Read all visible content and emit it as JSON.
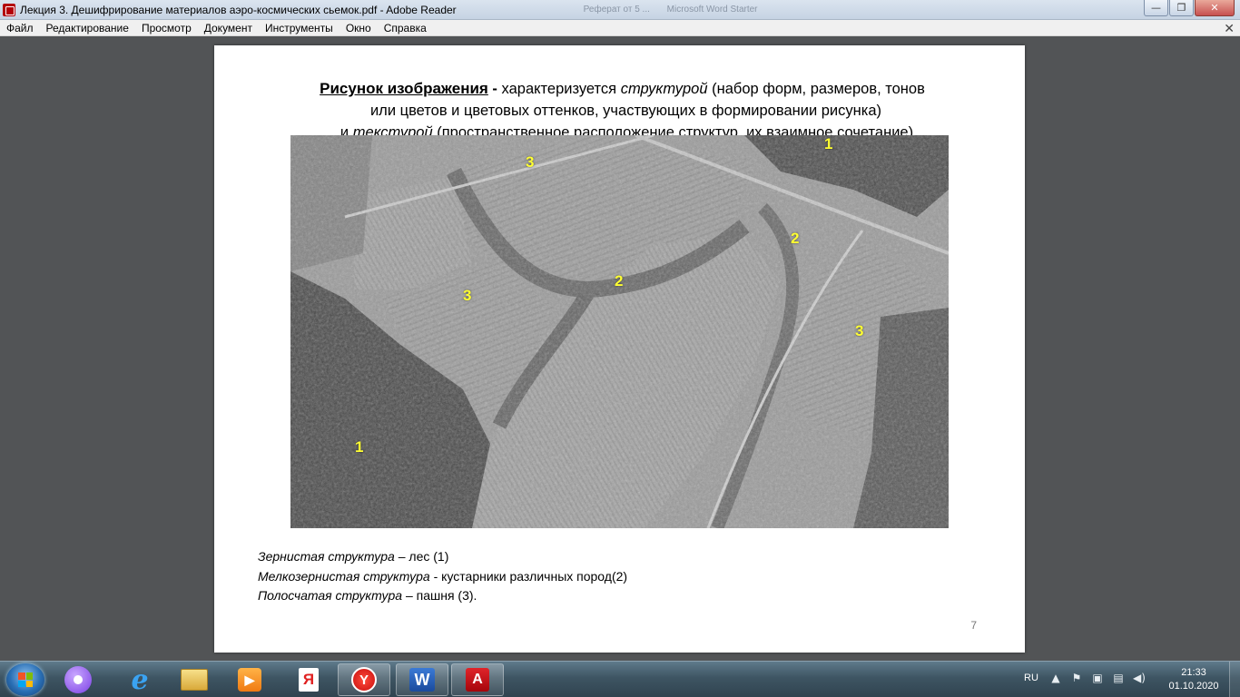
{
  "window": {
    "title": "Лекция 3. Дешифрирование материалов аэро-космических сьемок.pdf - Adobe Reader",
    "ghost_tabs": [
      "Реферат от 5 ...",
      "Microsoft Word Starter"
    ],
    "minimize_glyph": "—",
    "maximize_glyph": "❐",
    "close_glyph": "✕"
  },
  "menu": {
    "items": [
      "Файл",
      "Редактирование",
      "Просмотр",
      "Документ",
      "Инструменты",
      "Окно",
      "Справка"
    ],
    "close_glyph": "✕"
  },
  "slide": {
    "heading": {
      "lead": "Рисунок изображения",
      "dash": " -",
      "part1": " характеризуется ",
      "structure_word": "структурой",
      "part2": "  (набор форм, размеров, тонов",
      "line2": "или цветов и цветовых оттенков, участвующих в формировании рисунка)",
      "line3_a": "и ",
      "texture_word": "текстурой",
      "line3_b": " (пространственное расположение структур, их взаимное сочетание)"
    },
    "map_labels": [
      "1",
      "3",
      "2",
      "2",
      "3",
      "3",
      "1"
    ],
    "legend": [
      {
        "term": "Зернистая структура",
        "desc": " – лес (1)"
      },
      {
        "term": "Мелкозернистая структура",
        "desc": " - кустарники различных пород(2)"
      },
      {
        "term": "Полосчатая структура",
        "desc": " – пашня (3)."
      }
    ],
    "page_number": "7"
  },
  "taskbar": {
    "apps": [
      {
        "name": "alice-icon",
        "glyph": ""
      },
      {
        "name": "internet-explorer-icon",
        "glyph": "e"
      },
      {
        "name": "file-explorer-icon",
        "glyph": ""
      },
      {
        "name": "media-player-icon",
        "glyph": "▶"
      },
      {
        "name": "yandex-icon",
        "glyph": "Я"
      },
      {
        "name": "yandex-browser-icon",
        "glyph": "Y"
      },
      {
        "name": "word-icon",
        "glyph": "W"
      },
      {
        "name": "adobe-reader-icon",
        "glyph": "A"
      }
    ],
    "lang": "RU",
    "time": "21:33",
    "date": "01.10.2020"
  },
  "colors": {
    "label_yellow": "#ffff33",
    "doc_background": "#525456"
  }
}
